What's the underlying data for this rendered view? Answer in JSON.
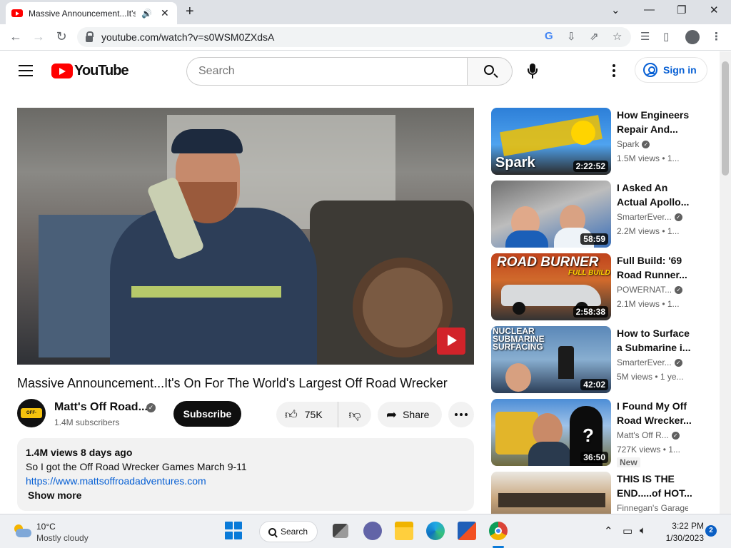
{
  "browser": {
    "tab_title": "Massive Announcement...It's",
    "tab_audio_icon": "speaker-icon",
    "tab_close": "✕",
    "new_tab": "+",
    "url": "youtube.com/watch?v=s0WSM0ZXdsA",
    "window_controls": {
      "minimize": "—",
      "maximize": "❐",
      "close": "✕",
      "tab_search": "⌄"
    }
  },
  "masthead": {
    "logo_text": "YouTube",
    "search_placeholder": "Search",
    "sign_in": "Sign in"
  },
  "video": {
    "title": "Massive Announcement...It's On For The World's Largest Off Road Wrecker",
    "channel_name": "Matt's Off Road...",
    "channel_avatar_text": "OFF-ROAD",
    "subscribers": "1.4M subscribers",
    "subscribe_label": "Subscribe",
    "likes": "75K",
    "share_label": "Share"
  },
  "description": {
    "views_date": "1.4M views  8 days ago",
    "line1": "So I got the Off Road Wrecker Games March 9-11",
    "link": "https://www.mattsoffroadadventures.com",
    "show_more": "Show more"
  },
  "recommendations": [
    {
      "title": "How Engineers Repair And...",
      "channel": "Spark",
      "verified": true,
      "meta": "1.5M views • 1...",
      "duration": "2:22:52",
      "thumb_text": "Spark",
      "new": ""
    },
    {
      "title": "I Asked An Actual Apollo...",
      "channel": "SmarterEver...",
      "verified": true,
      "meta": "2.2M views • 1...",
      "duration": "58:59",
      "thumb_text": "",
      "new": ""
    },
    {
      "title": "Full Build: '69 Road Runner...",
      "channel": "POWERNAT...",
      "verified": true,
      "meta": "2.1M views • 1...",
      "duration": "2:58:38",
      "thumb_text": "ROAD BURNER",
      "thumb_sub": "FULL BUILD",
      "new": ""
    },
    {
      "title": "How to Surface a Submarine i...",
      "channel": "SmarterEver...",
      "verified": true,
      "meta": "5M views • 1 ye...",
      "duration": "42:02",
      "thumb_text": "NUCLEAR SUBMARINE SURFACING",
      "new": ""
    },
    {
      "title": "I Found My Off Road Wrecker...",
      "channel": "Matt's Off R...",
      "verified": true,
      "meta": "727K views • 1...",
      "duration": "36:50",
      "thumb_text": "?",
      "new": "New"
    },
    {
      "title": "THIS IS THE END.....of HOT...",
      "channel": "Finnegan's Garage",
      "verified": false,
      "meta": "",
      "duration": "",
      "thumb_text": "",
      "new": ""
    }
  ],
  "taskbar": {
    "temperature": "10°C",
    "condition": "Mostly cloudy",
    "search_label": "Search",
    "time": "3:22 PM",
    "date": "1/30/2023",
    "notifications": "2"
  },
  "colors": {
    "youtube_red": "#ff0000",
    "link_blue": "#065fd4",
    "windows_blue": "#0a7ad8"
  }
}
